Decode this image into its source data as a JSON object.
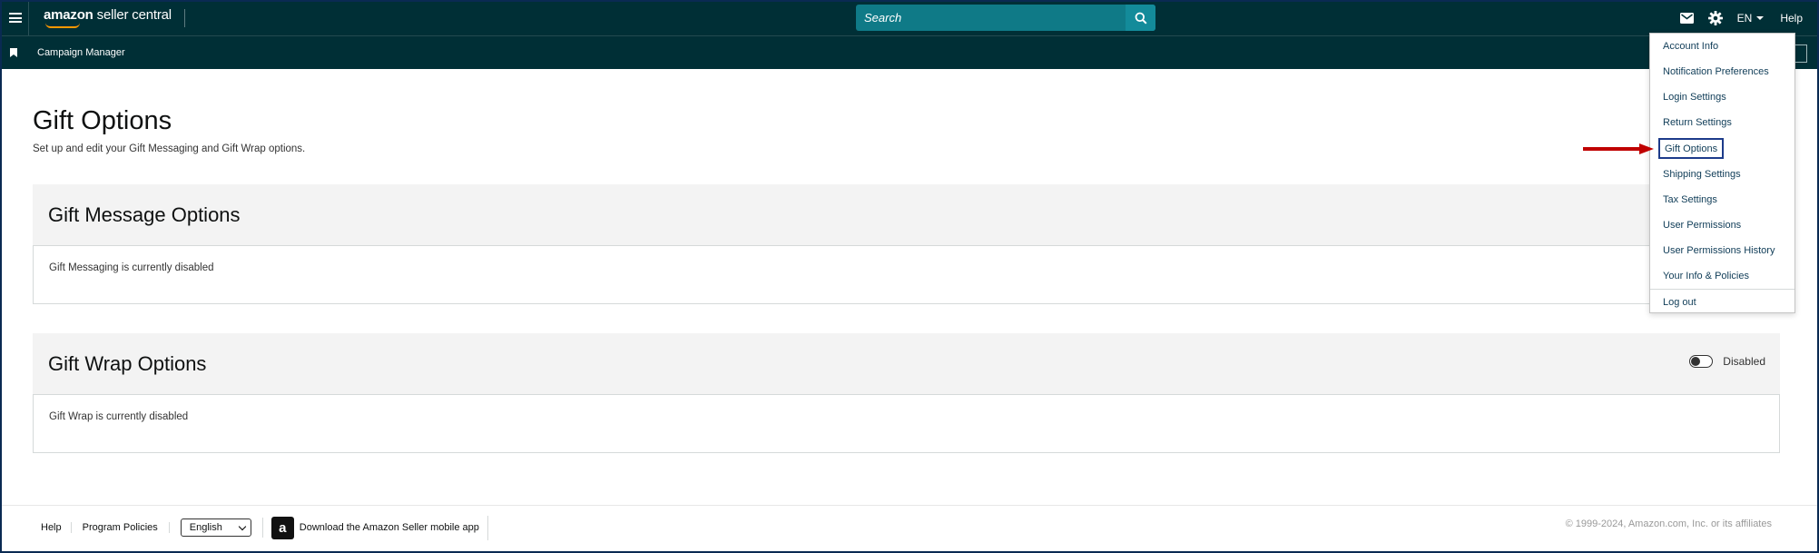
{
  "topbar": {
    "logo_brand": "amazon",
    "logo_product": "seller central",
    "search_placeholder": "Search",
    "lang": "EN",
    "help": "Help"
  },
  "subbar": {
    "campaign_manager": "Campaign Manager"
  },
  "page": {
    "title": "Gift Options",
    "subtitle": "Set up and edit your Gift Messaging and Gift Wrap options."
  },
  "gift_message": {
    "title": "Gift Message Options",
    "status": "Gift Messaging is currently disabled"
  },
  "gift_wrap": {
    "title": "Gift Wrap Options",
    "toggle_label": "Disabled",
    "status": "Gift Wrap is currently disabled"
  },
  "menu": {
    "items": [
      "Account Info",
      "Notification Preferences",
      "Login Settings",
      "Return Settings",
      "Gift Options",
      "Shipping Settings",
      "Tax Settings",
      "User Permissions",
      "User Permissions History",
      "Your Info & Policies"
    ],
    "logout": "Log out"
  },
  "footer": {
    "help": "Help",
    "program_policies": "Program Policies",
    "language": "English",
    "app_text": "Download the Amazon Seller mobile app",
    "app_icon_letter": "a",
    "copyright": "© 1999-2024, Amazon.com, Inc. or its affiliates"
  },
  "colors": {
    "header_bg": "#002f36",
    "search_bg": "#0f7a87",
    "highlight_border": "#1d3b8a",
    "arrow": "#c00000"
  }
}
